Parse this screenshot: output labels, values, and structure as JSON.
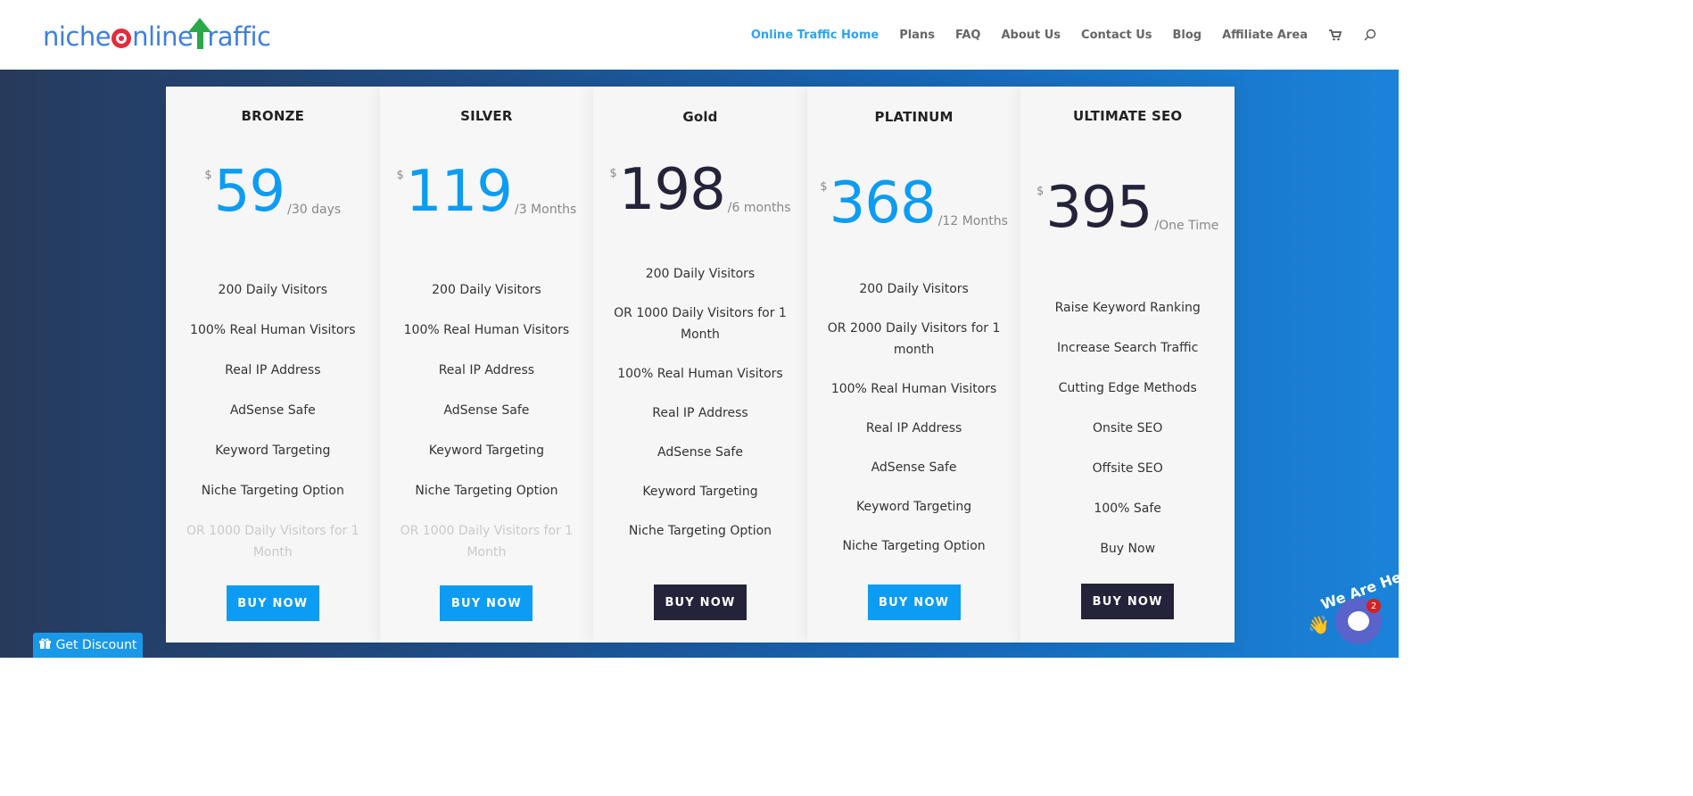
{
  "header": {
    "logo_text": {
      "part1": "niche",
      "part2": "nline",
      "part3": "raffic"
    },
    "nav": [
      {
        "label": "Online Traffic Home",
        "active": true
      },
      {
        "label": "Plans"
      },
      {
        "label": "FAQ"
      },
      {
        "label": "About Us"
      },
      {
        "label": "Contact Us"
      },
      {
        "label": "Blog"
      },
      {
        "label": "Affiliate Area"
      }
    ],
    "cart_icon": "cart-icon",
    "search_icon": "search-icon"
  },
  "plans": [
    {
      "title": "BRONZE",
      "currency": "$",
      "amount": "59",
      "period": "/30 days",
      "color": "#0c9cf3",
      "features": [
        "200 Daily Visitors",
        "100% Real Human Visitors",
        "Real IP Address",
        "AdSense Safe",
        "Keyword Targeting",
        "Niche Targeting Option"
      ],
      "faded_feature": "OR 1000 Daily Visitors for 1 Month",
      "button": "BUY NOW"
    },
    {
      "title": "SILVER",
      "currency": "$",
      "amount": "119",
      "period": "/3 Months",
      "color": "#0c9cf3",
      "features": [
        "200 Daily Visitors",
        "100% Real Human Visitors",
        "Real IP Address",
        "AdSense Safe",
        "Keyword Targeting",
        "Niche Targeting Option"
      ],
      "faded_feature": "OR 1000 Daily Visitors for 1 Month",
      "button": "BUY NOW"
    },
    {
      "title": "Gold",
      "currency": "$",
      "amount": "198",
      "period": "/6 months",
      "color": "#24233a",
      "features": [
        "200 Daily Visitors",
        "OR 1000 Daily Visitors for 1 Month",
        "100% Real Human Visitors",
        "Real IP Address",
        "AdSense Safe",
        "Keyword Targeting",
        "Niche Targeting Option"
      ],
      "button": "BUY NOW"
    },
    {
      "title": "PLATINUM",
      "currency": "$",
      "amount": "368",
      "period": "/12 Months",
      "color": "#0c9cf3",
      "features": [
        "200 Daily Visitors",
        "OR 2000 Daily Visitors for 1 month",
        "100% Real Human Visitors",
        "Real IP Address",
        "AdSense Safe",
        "Keyword Targeting",
        "Niche Targeting Option"
      ],
      "button": "BUY NOW"
    },
    {
      "title": "ULTIMATE SEO",
      "currency": "$",
      "amount": "395",
      "period": "/One Time",
      "color": "#24233a",
      "features": [
        "Raise Keyword Ranking",
        "Increase Search Traffic",
        "Cutting Edge Methods",
        "Onsite SEO",
        "Offsite SEO",
        "100% Safe",
        "Buy Now"
      ],
      "button": "BUY NOW"
    }
  ],
  "widgets": {
    "discount_label": "Get Discount",
    "chat_label": "We Are Here!",
    "chat_badge": "2"
  }
}
